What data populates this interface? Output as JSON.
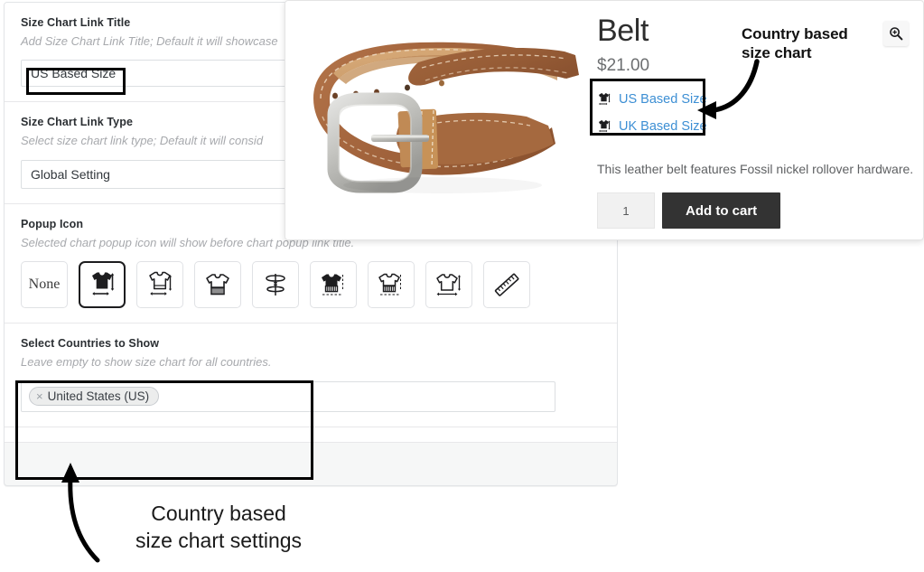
{
  "settings": {
    "fields": [
      {
        "id": "size-chart-link-title",
        "label": "Size Chart Link Title",
        "description": "Add Size Chart Link Title; Default it will showcase",
        "value": "US Based Size",
        "control": "text"
      },
      {
        "id": "size-chart-link-type",
        "label": "Size Chart Link Type",
        "description": "Select size chart link type; Default it will consid",
        "value": "Global Setting",
        "control": "select"
      },
      {
        "id": "popup-icon",
        "label": "Popup Icon",
        "description": "Selected chart popup icon will show before chart popup link title.",
        "control": "icon-picker"
      },
      {
        "id": "select-countries-to-show",
        "label": "Select Countries to Show",
        "description": "Leave empty to show size chart for all countries.",
        "control": "chips"
      }
    ],
    "popup_icons": [
      {
        "name": "none-icon",
        "label": "None",
        "selected": false
      },
      {
        "name": "tshirt-filled-measure-icon",
        "label": "",
        "selected": true
      },
      {
        "name": "tshirt-outline-measure-icon",
        "label": "",
        "selected": false
      },
      {
        "name": "tshirt-tape-icon",
        "label": "",
        "selected": false
      },
      {
        "name": "measuring-tape-icon",
        "label": "",
        "selected": false
      },
      {
        "name": "tshirt-filled-ruler-icon",
        "label": "",
        "selected": false
      },
      {
        "name": "tshirt-outline-ruler-icon",
        "label": "",
        "selected": false
      },
      {
        "name": "tshirt-arrows-icon",
        "label": "",
        "selected": false
      },
      {
        "name": "ruler-diagonal-icon",
        "label": "",
        "selected": false
      }
    ],
    "country_chips": [
      {
        "remove_symbol": "×",
        "label": "United States (US)"
      }
    ]
  },
  "product": {
    "title": "Belt",
    "price": "$21.00",
    "description": "This leather belt features Fossil nickel rollover hardware.",
    "quantity": "1",
    "add_to_cart_label": "Add to cart",
    "zoom_icon": "magnifier-plus-icon",
    "image_alt": "brown-leather-belt-photo",
    "size_links": [
      {
        "icon": "tshirt-measure-icon",
        "label": "US Based Size"
      },
      {
        "icon": "tshirt-measure-icon",
        "label": "UK Based Size"
      }
    ]
  },
  "annotations": {
    "top": "Country based\nsize chart",
    "top_line1": "Country based",
    "top_line2": "size chart",
    "bottom_line1": "Country based",
    "bottom_line2": "size chart settings"
  },
  "colors": {
    "link_blue": "#3d8fd4",
    "button_dark": "#333333",
    "panel_bg": "#f6f7f7",
    "border_gray": "#dcdfe2",
    "muted_text": "#a7a9ad"
  }
}
